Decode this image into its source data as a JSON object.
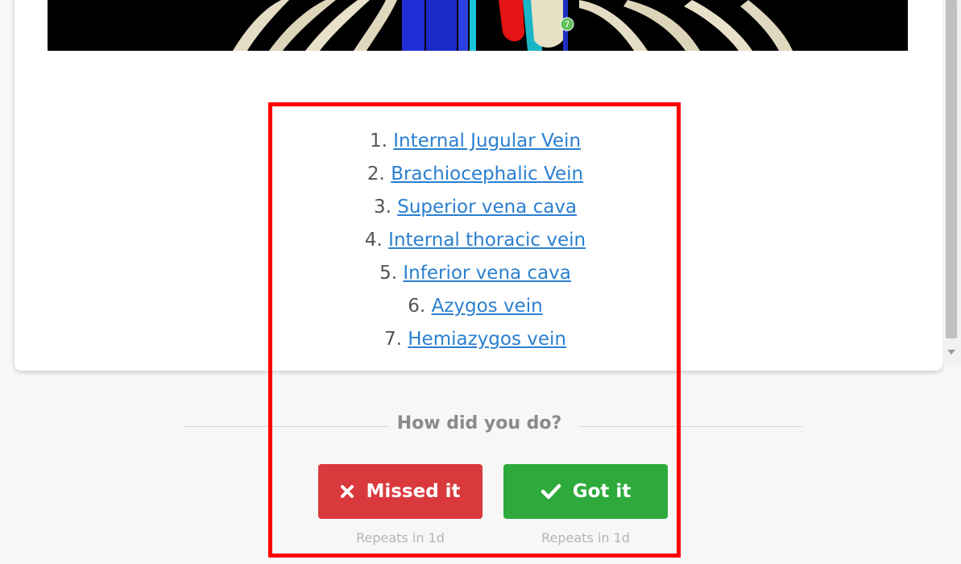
{
  "structures": [
    {
      "number": "1.",
      "label": "Internal Jugular Vein"
    },
    {
      "number": "2.",
      "label": "Brachiocephalic Vein"
    },
    {
      "number": "3.",
      "label": "Superior vena cava"
    },
    {
      "number": "4.",
      "label": "Internal thoracic vein"
    },
    {
      "number": "5.",
      "label": "Inferior vena cava"
    },
    {
      "number": "6.",
      "label": "Azygos vein"
    },
    {
      "number": "7.",
      "label": "Hemiazygos vein"
    }
  ],
  "image_marker": "7",
  "feedback": {
    "prompt": "How did you do?",
    "missed_label": "Missed it",
    "got_label": "Got it",
    "missed_repeat": "Repeats in 1d",
    "got_repeat": "Repeats in 1d",
    "missed_icon": "x-icon",
    "got_icon": "check-icon",
    "missed_color": "#d9393c",
    "got_color": "#2eaa3c",
    "link_color": "#2a7fcf",
    "highlight_color": "#ff0000"
  }
}
